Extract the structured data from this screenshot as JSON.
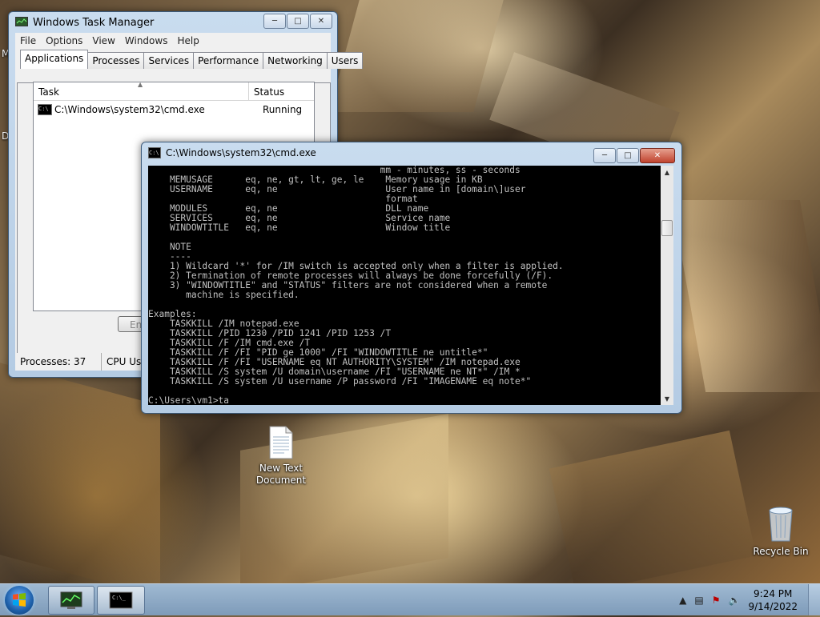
{
  "task_manager": {
    "title": "Windows Task Manager",
    "menu": [
      "File",
      "Options",
      "View",
      "Windows",
      "Help"
    ],
    "tabs": [
      "Applications",
      "Processes",
      "Services",
      "Performance",
      "Networking",
      "Users"
    ],
    "columns": [
      "Task",
      "Status"
    ],
    "rows": [
      {
        "task": "C:\\Windows\\system32\\cmd.exe",
        "status": "Running"
      }
    ],
    "end_task_partial": "En",
    "status_processes": "Processes: 37",
    "status_cpu": "CPU Usag"
  },
  "cmd": {
    "title": "C:\\Windows\\system32\\cmd.exe",
    "lines": [
      "                                           mm - minutes, ss - seconds",
      "    MEMUSAGE      eq, ne, gt, lt, ge, le    Memory usage in KB",
      "    USERNAME      eq, ne                    User name in [domain\\]user",
      "                                            format",
      "    MODULES       eq, ne                    DLL name",
      "    SERVICES      eq, ne                    Service name",
      "    WINDOWTITLE   eq, ne                    Window title",
      "",
      "    NOTE",
      "    ----",
      "    1) Wildcard '*' for /IM switch is accepted only when a filter is applied.",
      "    2) Termination of remote processes will always be done forcefully (/F).",
      "    3) \"WINDOWTITLE\" and \"STATUS\" filters are not considered when a remote",
      "       machine is specified.",
      "",
      "Examples:",
      "    TASKKILL /IM notepad.exe",
      "    TASKKILL /PID 1230 /PID 1241 /PID 1253 /T",
      "    TASKKILL /F /IM cmd.exe /T",
      "    TASKKILL /F /FI \"PID ge 1000\" /FI \"WINDOWTITLE ne untitle*\"",
      "    TASKKILL /F /FI \"USERNAME eq NT AUTHORITY\\SYSTEM\" /IM notepad.exe",
      "    TASKKILL /S system /U domain\\username /FI \"USERNAME ne NT*\" /IM *",
      "    TASKKILL /S system /U username /P password /FI \"IMAGENAME eq note*\"",
      "",
      "C:\\Users\\vm1>ta"
    ]
  },
  "desktop": {
    "icons": [
      {
        "label": "New Text\nDocument"
      },
      {
        "label": "Recycle Bin"
      }
    ],
    "edge_letters": [
      "M",
      "D"
    ]
  },
  "taskbar": {
    "time": "9:24 PM",
    "date": "9/14/2022"
  }
}
